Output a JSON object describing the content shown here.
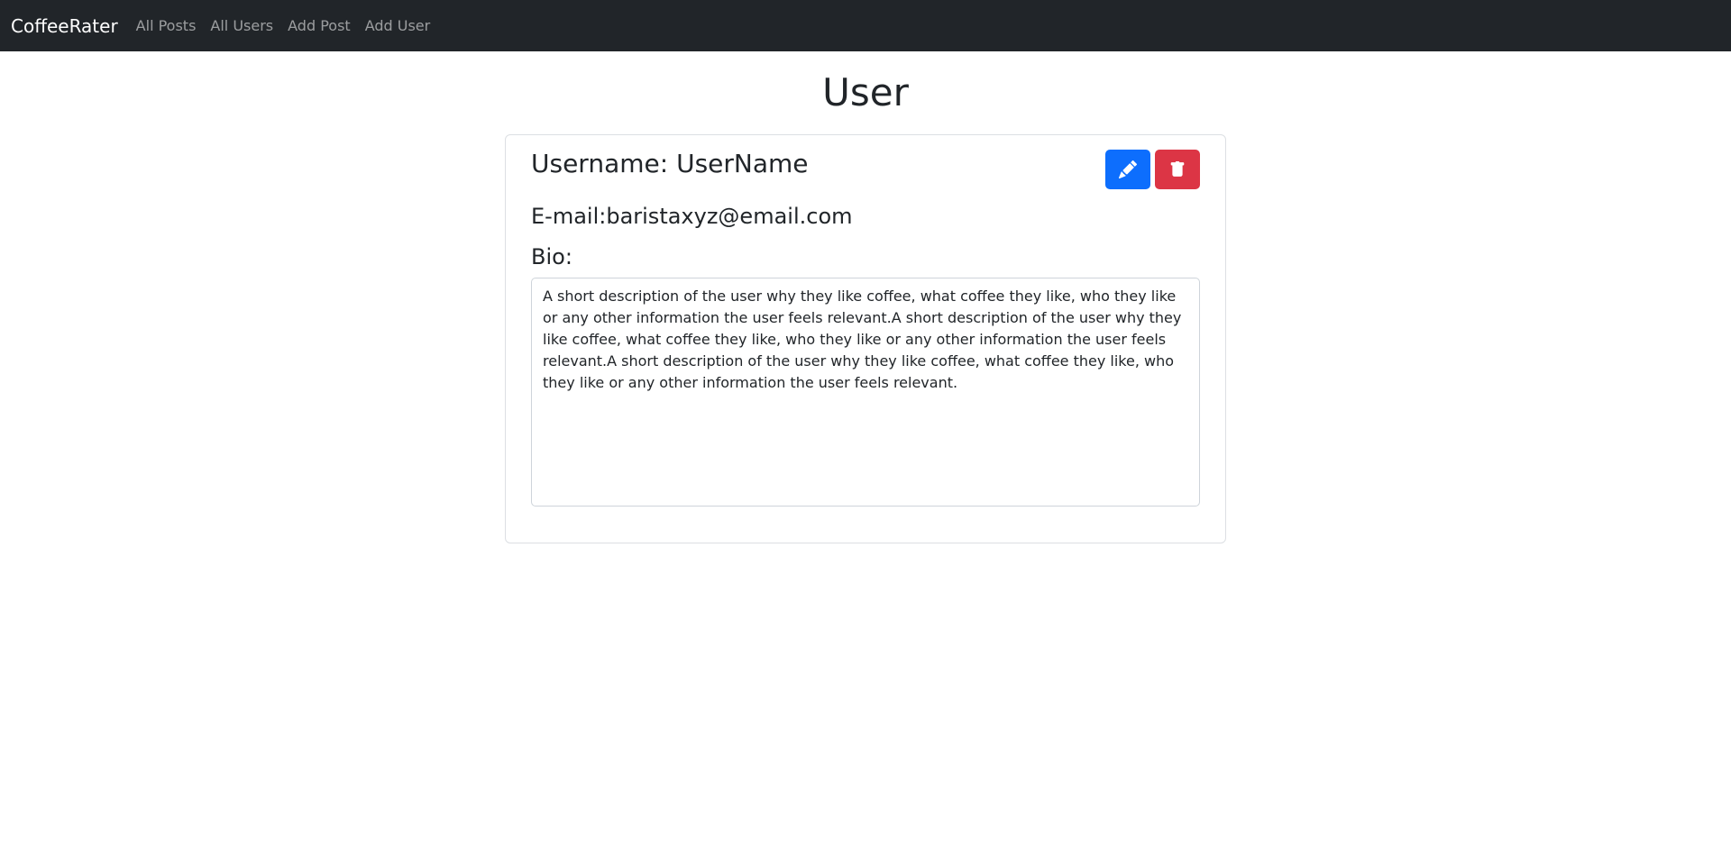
{
  "navbar": {
    "brand": "CoffeeRater",
    "links": [
      "All Posts",
      "All Users",
      "Add Post",
      "Add User"
    ]
  },
  "page": {
    "title": "User"
  },
  "user": {
    "username_line": "Username: UserName",
    "email_line": "E-mail:baristaxyz@email.com",
    "bio_label": "Bio:",
    "bio": "A short description of the user why they like coffee, what coffee they like, who they like or any other information the user feels relevant.A short description of the user why they like coffee, what coffee they like, who they like or any other information the user feels relevant.A short description of the user why they like coffee, what coffee they like, who they like or any other information the user feels relevant."
  },
  "actions": {
    "edit_icon": "pencil-icon",
    "delete_icon": "trash-icon"
  },
  "colors": {
    "navbar_bg": "#212529",
    "edit_button": "#0d6efd",
    "delete_button": "#dc3545"
  }
}
